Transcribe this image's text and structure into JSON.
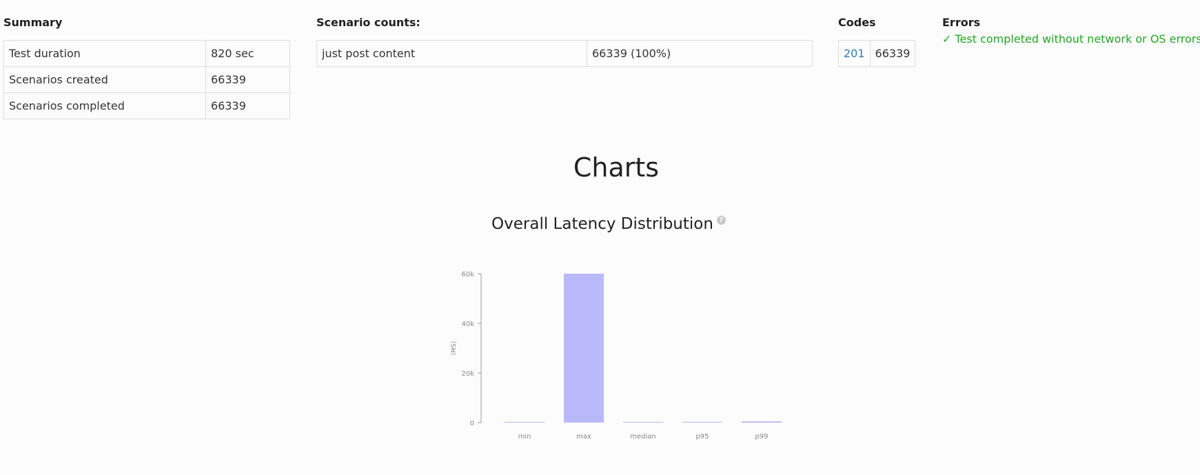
{
  "summary": {
    "heading": "Summary",
    "rows": [
      {
        "label": "Test duration",
        "value": "820 sec"
      },
      {
        "label": "Scenarios created",
        "value": "66339"
      },
      {
        "label": "Scenarios completed",
        "value": "66339"
      }
    ]
  },
  "scenario_counts": {
    "heading": "Scenario counts:",
    "rows": [
      {
        "label": "just post content",
        "value": "66339 (100%)"
      }
    ]
  },
  "codes": {
    "heading": "Codes",
    "rows": [
      {
        "code": "201",
        "count": "66339"
      }
    ]
  },
  "errors": {
    "heading": "Errors",
    "message": "✓ Test completed without network or OS errors.",
    "color": "#22a822"
  },
  "charts": {
    "heading": "Charts"
  },
  "chart_data": {
    "type": "bar",
    "title": "Overall Latency Distribution",
    "help_icon": "question-circle-icon",
    "ylabel": "(MS)",
    "xlabel": "",
    "categories": [
      "min",
      "max",
      "median",
      "p95",
      "p99"
    ],
    "values": [
      0,
      60000,
      100,
      300,
      500
    ],
    "ylim": [
      0,
      60000
    ],
    "y_ticks": [
      0,
      20000,
      40000,
      60000
    ],
    "y_tick_labels": [
      "0",
      "20k",
      "40k",
      "60k"
    ],
    "bar_color": "#b8b8fa",
    "grid": false,
    "legend": "none"
  }
}
